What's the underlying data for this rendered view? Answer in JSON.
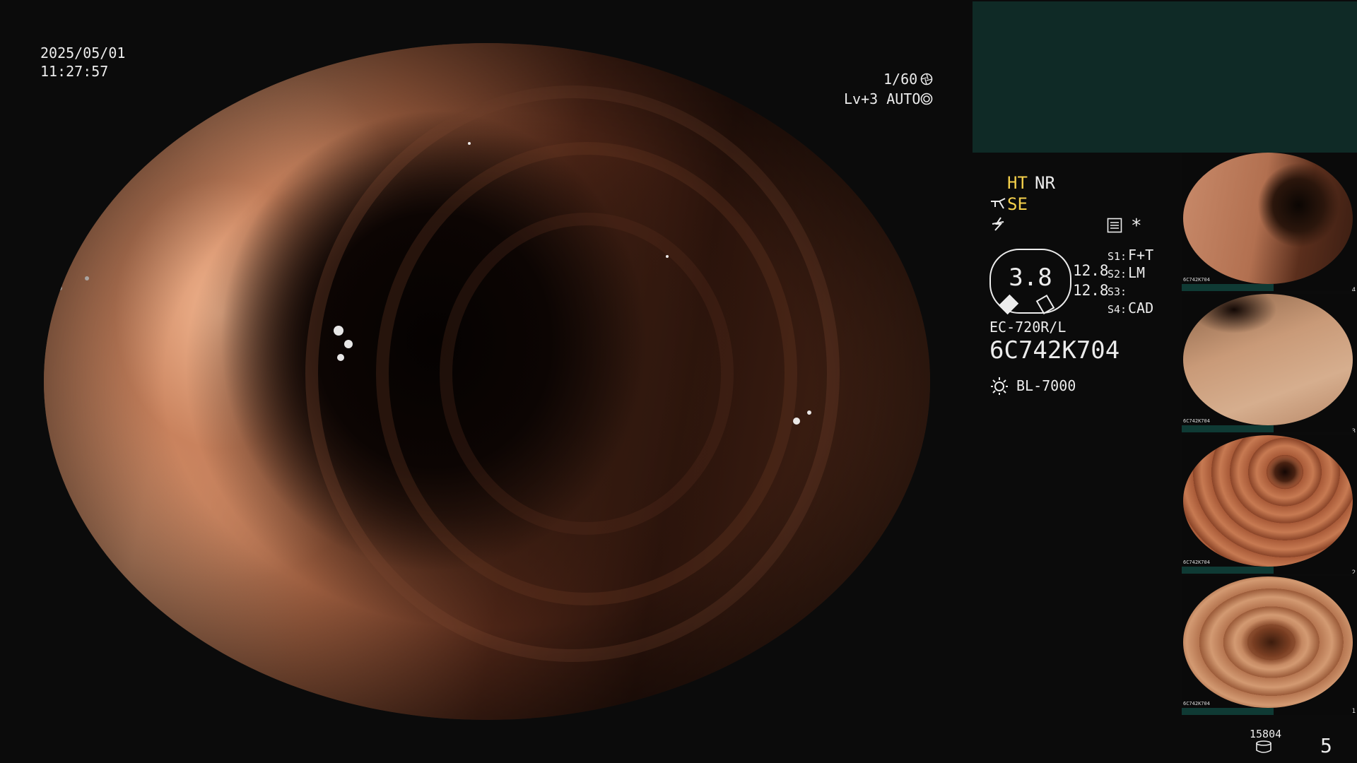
{
  "main": {
    "date": "2025/05/01",
    "time": "11:27:57",
    "shutter": "1/60",
    "exposure": "Lv+3 AUTO"
  },
  "panel": {
    "modes": {
      "ht": "HT",
      "nr": "NR",
      "se": "SE"
    },
    "magnification": "3.8",
    "gauge_values": [
      "12.8",
      "12.8"
    ],
    "switch_labels": [
      {
        "key": "S1:",
        "value": "F+T"
      },
      {
        "key": "S2:",
        "value": "LM"
      },
      {
        "key": "S3:",
        "value": ""
      },
      {
        "key": "S4:",
        "value": "CAD"
      }
    ],
    "scope_model": "EC-720R/L",
    "scope_serial": "6C742K704",
    "light_source": "BL-7000",
    "asterisk": "*"
  },
  "thumbnails": [
    {
      "label": "6C742K704",
      "index": "4"
    },
    {
      "label": "6C742K704",
      "index": "3"
    },
    {
      "label": "6C742K704",
      "index": "2"
    },
    {
      "label": "6C742K704",
      "index": "1"
    }
  ],
  "footer": {
    "capture_count": "15804",
    "image_count": "5"
  },
  "colors": {
    "accent_yellow": "#f4d04b",
    "info_box": "#0f2a26",
    "text": "#ececec"
  },
  "icons": {
    "shutter": "aperture-icon",
    "exposure": "exposure-ring-icon",
    "se": "scissor-mode-icon",
    "lightning": "lightning-icon",
    "record": "record-card-icon",
    "light": "sun-icon",
    "database": "database-icon"
  }
}
